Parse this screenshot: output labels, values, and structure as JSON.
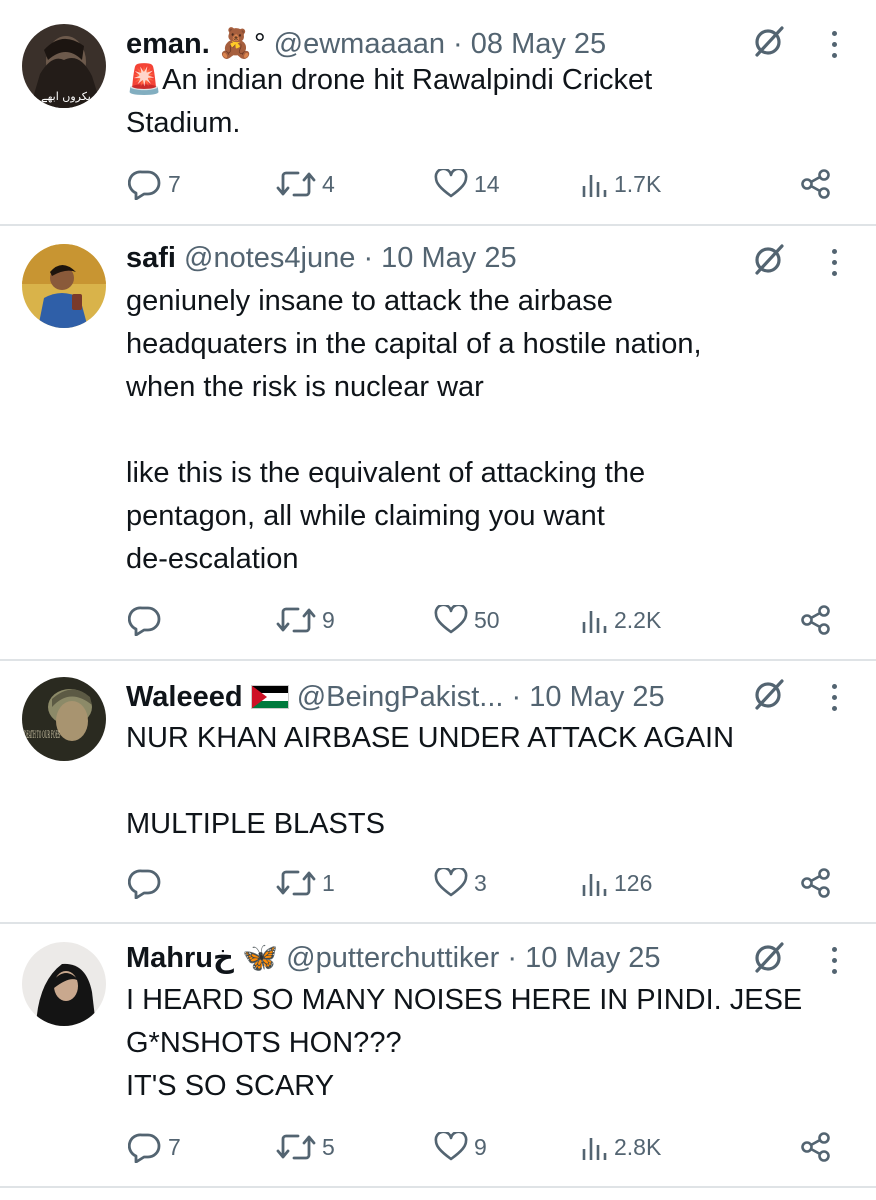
{
  "tweets": [
    {
      "name": "eman.",
      "name_emoji": "🧸°",
      "handle": "@ewmaaaan",
      "date": "· 08 May 25",
      "alert_emoji": "🚨",
      "lines": [
        "An indian drone hit Rawalpindi Cricket",
        "Stadium."
      ],
      "replies": "7",
      "reposts": "4",
      "likes": "14",
      "views": "1.7K",
      "avatar_colors": [
        "#5a4a3e",
        "#2b2420"
      ]
    },
    {
      "name": "safi",
      "name_emoji": "",
      "handle": "@notes4june",
      "date": "· 10 May 25",
      "lines": [
        "geniunely insane to attack the airbase",
        "headquaters in the capital of a hostile nation,",
        "when the risk is nuclear war",
        "",
        "like this is the equivalent of attacking the",
        "pentagon, all while claiming you want",
        "de-escalation"
      ],
      "replies": "",
      "reposts": "9",
      "likes": "50",
      "views": "2.2K",
      "avatar_colors": [
        "#c9a23a",
        "#6c4a1d"
      ]
    },
    {
      "name": "Waleeed",
      "name_emoji": "",
      "handle": "@BeingPakist...",
      "date": "· 10 May 25",
      "avatar_text": "DEATH TO OUR FOES",
      "lines": [
        "NUR KHAN AIRBASE UNDER ATTACK AGAIN",
        "",
        "MULTIPLE BLASTS"
      ],
      "replies": "",
      "reposts": "1",
      "likes": "3",
      "views": "126",
      "avatar_colors": [
        "#6b6a52",
        "#1e1d16"
      ]
    },
    {
      "name": "Mahruخ",
      "name_emoji": "🦋",
      "handle": "@putterchuttiker",
      "date": "· 10 May 25",
      "lines": [
        "I HEARD SO MANY NOISES HERE IN PINDI. JESE",
        "G*NSHOTS HON???",
        "IT'S SO SCARY"
      ],
      "replies": "7",
      "reposts": "5",
      "likes": "9",
      "views": "2.8K",
      "avatar_colors": [
        "#e8e4e2",
        "#1a1a1a"
      ]
    }
  ],
  "colors": {
    "text": "#0f1419",
    "secondary": "#536471",
    "divider": "#dfe3e6",
    "flag_green": "#007a3d",
    "flag_red": "#ce1126"
  }
}
